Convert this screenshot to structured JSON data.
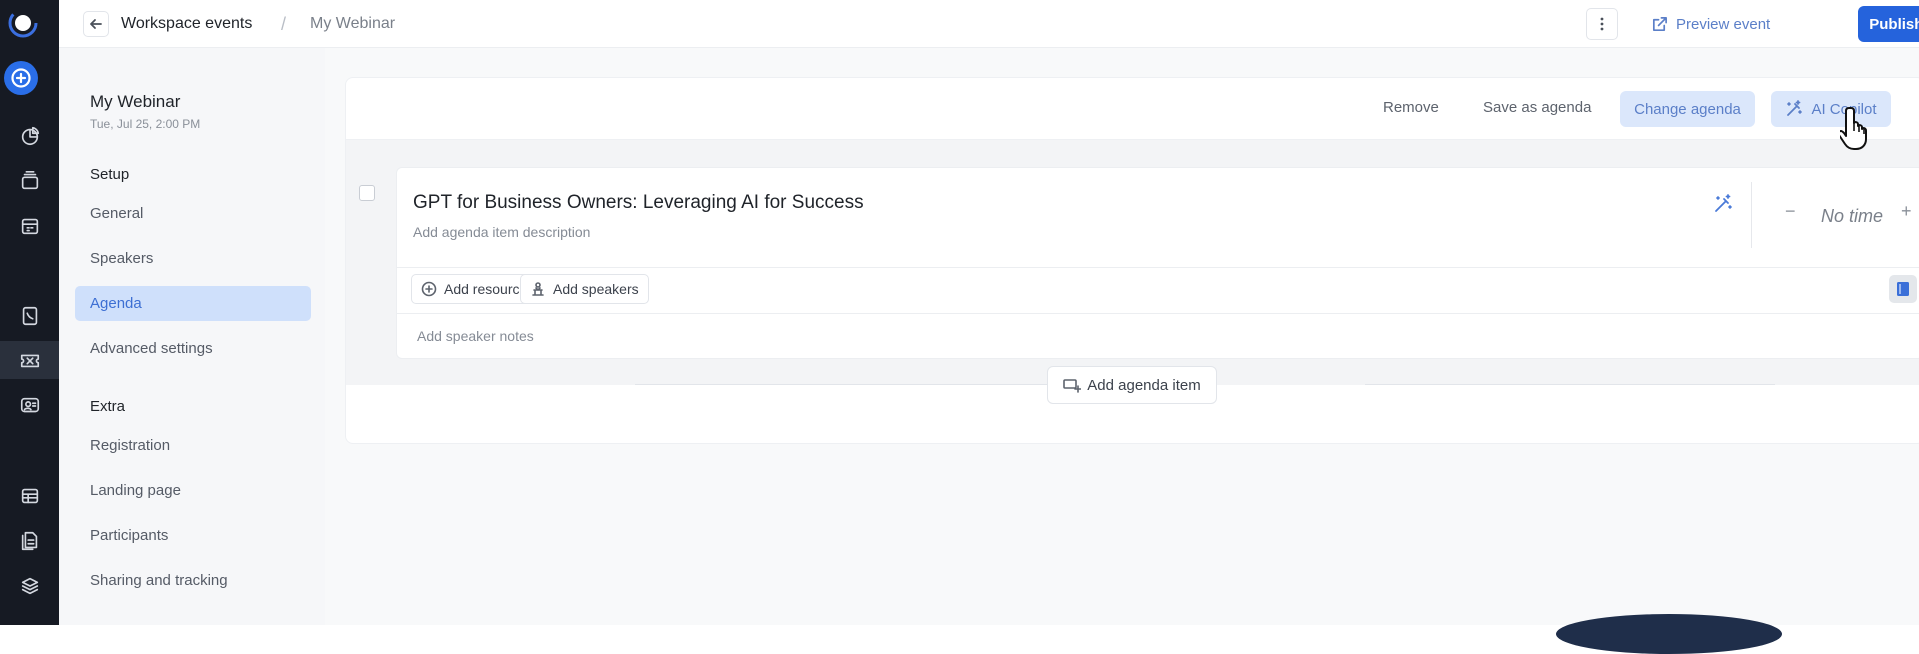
{
  "topbar": {
    "breadcrumb_parent": "Workspace events",
    "breadcrumb_separator": "/",
    "breadcrumb_current": "My Webinar",
    "preview_label": "Preview event",
    "publish_label": "Publish event"
  },
  "sidebar": {
    "event_title": "My Webinar",
    "event_date": "Tue, Jul 25, 2:00 PM",
    "setup_heading": "Setup",
    "setup_items": [
      "General",
      "Speakers",
      "Agenda",
      "Advanced settings"
    ],
    "extra_heading": "Extra",
    "extra_items": [
      "Registration",
      "Landing page",
      "Participants",
      "Sharing and tracking"
    ],
    "active_item": "Agenda"
  },
  "toolbar": {
    "remove_label": "Remove",
    "save_as_agenda_label": "Save as agenda",
    "change_agenda_label": "Change agenda",
    "ai_copilot_label": "AI Copilot"
  },
  "agenda_item": {
    "title": "GPT for Business Owners: Leveraging AI for Success",
    "description_placeholder": "Add agenda item description",
    "time_minus": "−",
    "time_value": "No time",
    "time_plus": "+",
    "add_resource_label": "Add resource",
    "add_speakers_label": "Add speakers",
    "speaker_notes_placeholder": "Add speaker notes"
  },
  "add_agenda_item_label": "Add agenda item",
  "colors": {
    "primary": "#2563dc",
    "accent_light": "#dbe7fb",
    "rail_bg": "#161a23",
    "sidebar_active": "#cfe0fb"
  },
  "icons": {
    "rail": [
      "logo-icon",
      "create-icon",
      "analytics-icon",
      "layers-icon",
      "calendar-icon",
      "phone-book-icon",
      "ticket-icon",
      "presenter-icon",
      "table-icon",
      "document-icon",
      "stack-icon"
    ]
  }
}
